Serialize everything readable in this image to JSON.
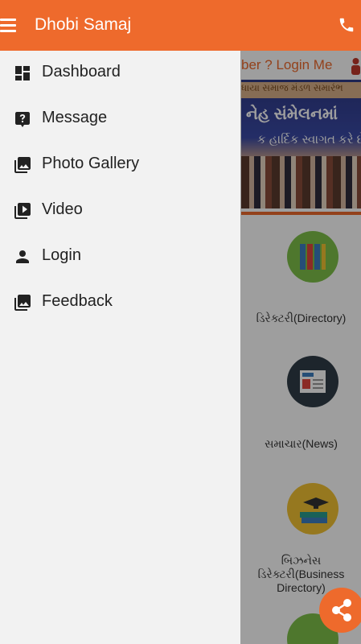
{
  "appbar": {
    "title": "Dhobi Samaj",
    "bg_color": "#ee6a2c",
    "menu_icon": "hamburger-menu-icon",
    "call_icon": "phone-icon"
  },
  "page": {
    "login_text": "ber ? Login Me",
    "banner": {
      "line1": "ધાયા સમાજ મંડળ સમારંભ",
      "line2": "નેહ સંમેલનમાં",
      "line3": "ક હાર્દિક સ્વાગત કરે છે"
    },
    "tiles": [
      {
        "label": "ડિરેક્ટરી(Directory)",
        "icon": "directory-binders-icon",
        "color": "#7ec04a"
      },
      {
        "label": "સમાચાર(News)",
        "icon": "newspaper-icon",
        "color": "#2f3d47"
      },
      {
        "label_line1": "બિઝનેસ",
        "label_line2": "ડિરેક્ટરી(Business",
        "label_line3": "Directory)",
        "icon": "business-books-icon",
        "color": "#f2c233"
      }
    ],
    "fab_icon": "share-icon"
  },
  "drawer": {
    "items": [
      {
        "label": "Dashboard",
        "icon": "dashboard-icon"
      },
      {
        "label": "Message",
        "icon": "help-message-icon"
      },
      {
        "label": "Photo Gallery",
        "icon": "photo-library-icon"
      },
      {
        "label": "Video",
        "icon": "video-library-icon"
      },
      {
        "label": "Login",
        "icon": "person-icon"
      },
      {
        "label": "Feedback",
        "icon": "photo-library-icon"
      }
    ]
  }
}
